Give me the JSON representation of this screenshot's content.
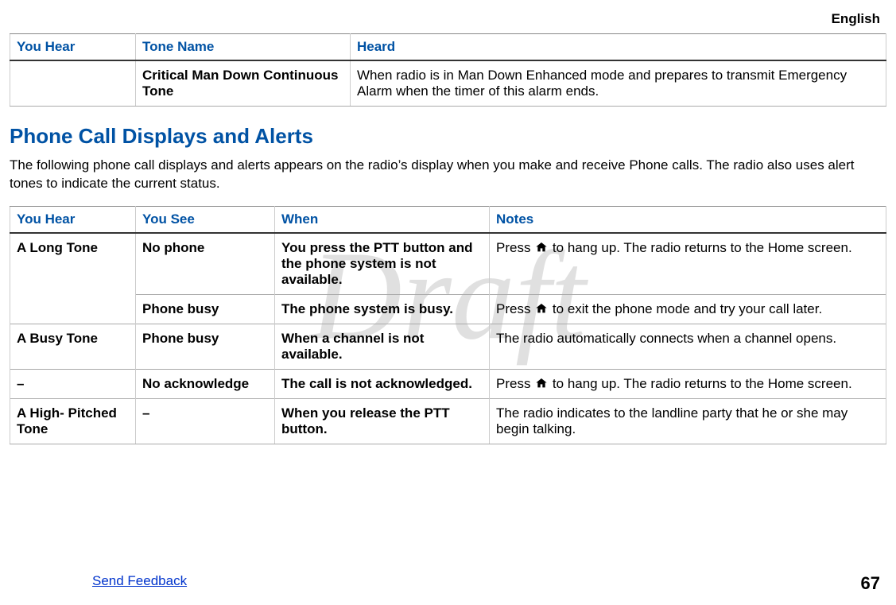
{
  "header": {
    "language": "English"
  },
  "watermark": "Draft",
  "table1": {
    "headers": [
      "You Hear",
      "Tone Name",
      "Heard"
    ],
    "rows": [
      {
        "hear": "",
        "tone": "Critical Man Down Contin­uous Tone",
        "heard": "When radio is in Man Down Enhanced mode and prepares to transmit Emergency Alarm when the timer of this alarm ends."
      }
    ]
  },
  "section": {
    "title": "Phone Call Displays and Alerts",
    "intro": "The following phone call displays and alerts appears on the radio’s display when you make and receive Phone calls. The radio also uses alert tones to indicate the current status."
  },
  "table2": {
    "headers": [
      "You Hear",
      "You See",
      "When",
      "Notes"
    ],
    "rows": [
      {
        "hear": "A Long Tone",
        "see": "No phone",
        "when": "You press the PTT button and the phone system is not available.",
        "notes_before": "Press ",
        "notes_after": " to hang up. The radio returns to the Home screen."
      },
      {
        "see": "Phone busy",
        "when": "The phone system is busy.",
        "notes_before": "Press ",
        "notes_after": " to exit the phone mode and try your call later."
      },
      {
        "hear": "A Busy Tone",
        "see": "Phone busy",
        "when": "When a channel is not available.",
        "notes": "The radio automatically connects when a channel opens."
      },
      {
        "hear": "–",
        "see": "No acknowl­edge",
        "when": "The call is not acknowl­edged.",
        "notes_before": "Press ",
        "notes_after": " to hang up. The radio returns to the Home screen."
      },
      {
        "hear": "A High- Pitch­ed Tone",
        "see": "–",
        "when": "When you release the PTT button.",
        "notes": "The radio indicates to the landline party that he or she may begin talking."
      }
    ]
  },
  "footer": {
    "feedback": "Send Feedback",
    "page": "67"
  }
}
